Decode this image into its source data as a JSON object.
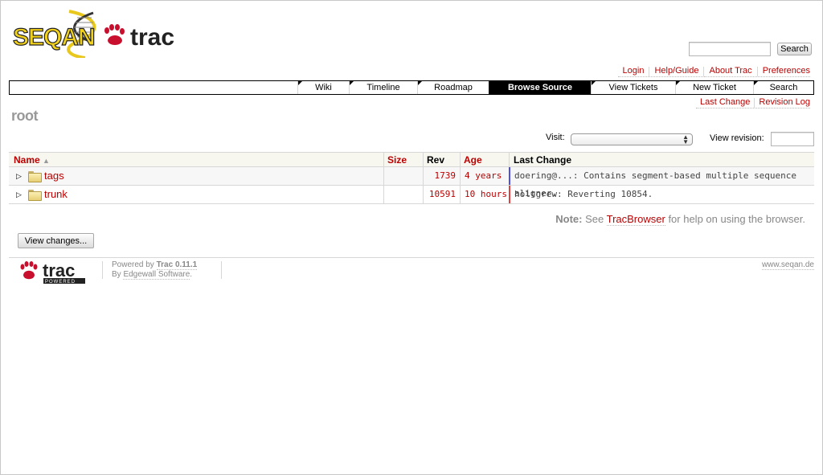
{
  "header": {
    "logo_text_left": "SEQAN",
    "logo_text_right": "trac",
    "search_button": "Search"
  },
  "metanav": [
    {
      "label": "Login"
    },
    {
      "label": "Help/Guide"
    },
    {
      "label": "About Trac"
    },
    {
      "label": "Preferences"
    }
  ],
  "mainnav": [
    {
      "label": "Wiki"
    },
    {
      "label": "Timeline"
    },
    {
      "label": "Roadmap"
    },
    {
      "label": "Browse Source",
      "active": true
    },
    {
      "label": "View Tickets"
    },
    {
      "label": "New Ticket"
    },
    {
      "label": "Search"
    }
  ],
  "ctxtnav": [
    {
      "label": "Last Change"
    },
    {
      "label": "Revision Log"
    }
  ],
  "page": {
    "title": "root",
    "visit_label": "Visit:",
    "visit_value": "",
    "view_revision_label": "View revision:",
    "view_revision_value": ""
  },
  "table": {
    "columns": {
      "name": "Name",
      "size": "Size",
      "rev": "Rev",
      "age": "Age",
      "last_change": "Last Change"
    },
    "rows": [
      {
        "name": "tags",
        "size": "",
        "rev": "1739",
        "age": "4 years",
        "change": "doering@...: Contains segment-based multiple sequence aligner.",
        "age_color": "#5050e0"
      },
      {
        "name": "trunk",
        "size": "",
        "rev": "10591",
        "age": "10 hours",
        "change": "holtgrew: Reverting 10854.",
        "age_color": "#e04040"
      }
    ]
  },
  "help": {
    "note": "Note:",
    "see": "See",
    "link": "TracBrowser",
    "rest": "for help on using the browser."
  },
  "view_changes_button": "View changes...",
  "footer": {
    "logo_text": "trac",
    "logo_sub": "POWERED",
    "powered_by": "Powered by",
    "trac_version": "Trac 0.11.1",
    "by": "By",
    "company": "Edgewall Software",
    "site": "www.seqan.de"
  },
  "colors": {
    "link": "#bb0000",
    "nav_active_bg": "#000000",
    "header_bg": "#f7f7f0"
  }
}
